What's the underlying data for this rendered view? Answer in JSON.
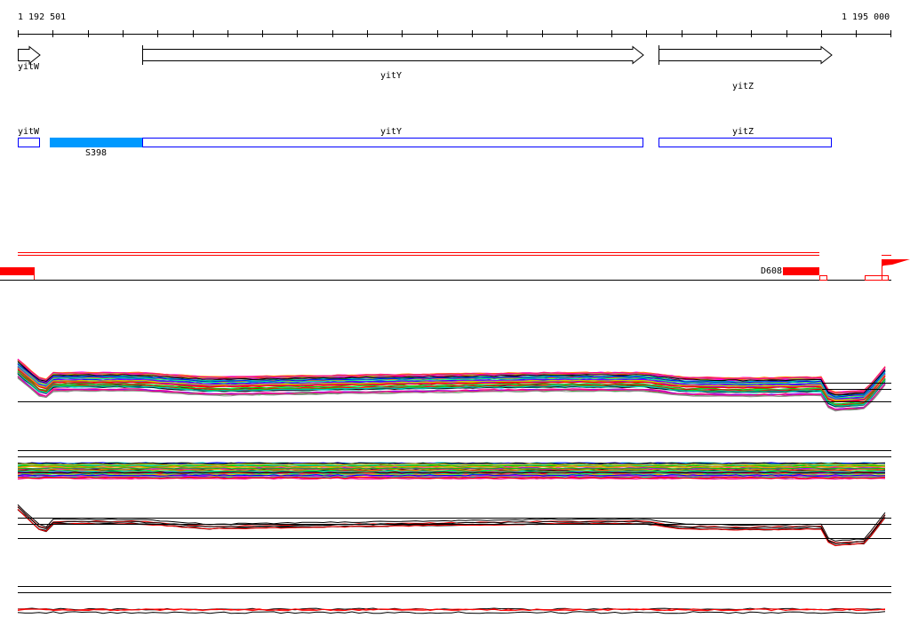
{
  "ruler": {
    "start_label": "1 192 501",
    "end_label": "1 195 000"
  },
  "genes": [
    {
      "name": "yitW",
      "label": "yitW"
    },
    {
      "name": "yitY",
      "label": "yitY"
    },
    {
      "name": "yitZ",
      "label": "yitZ"
    }
  ],
  "features": {
    "cds": [
      {
        "label": "yitW"
      },
      {
        "label": "yitY"
      },
      {
        "label": "yitZ"
      }
    ],
    "segment": {
      "label": "S398",
      "color": "#0099ff"
    },
    "outline_color": "#0000ff"
  },
  "signal_track": {
    "label": "D608",
    "color": "#ff0000"
  },
  "line_tracks": {
    "palette": [
      "#ff0000",
      "#00cc00",
      "#0000ff",
      "#ff00ff",
      "#00cccc",
      "#cccc00",
      "#ff8800",
      "#8800ff",
      "#000000",
      "#888888",
      "#00ff88",
      "#ff0088"
    ],
    "profile_x": [
      0,
      3,
      4,
      14,
      22,
      40,
      61,
      72,
      76,
      83,
      92,
      93,
      97,
      100
    ],
    "profile_y": [
      0.2,
      0.7,
      0.5,
      0.5,
      0.6,
      0.55,
      0.5,
      0.5,
      0.6,
      0.62,
      0.6,
      0.95,
      0.9,
      0.2
    ]
  }
}
